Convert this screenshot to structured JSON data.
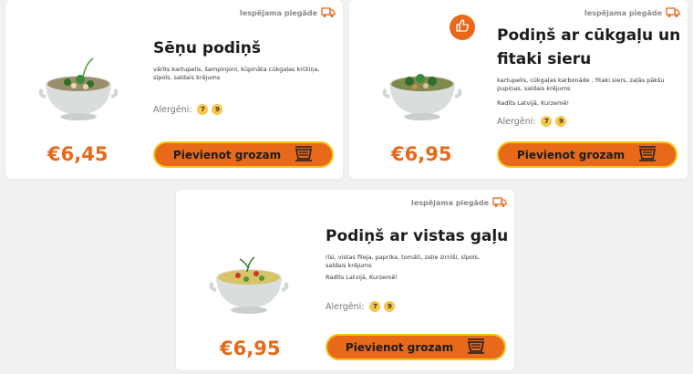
{
  "delivery_label": "Iespējama piegāde",
  "allergens_label": "Alergēni:",
  "cart_button_label": "Pievienot grozam",
  "colors": {
    "accent": "#e8691a",
    "button_border": "#f5c518",
    "badge": "#f7c64a"
  },
  "products": [
    {
      "title": "Sēņu podiņš",
      "ingredients": "vārīts kartupelis, šampinjoni,  kūpināta cūkgaļas krūtiņa, sīpols, saldais krējums",
      "origin": "",
      "allergens": [
        "7",
        "9"
      ],
      "price": "€6,45"
    },
    {
      "title": "Podiņš ar cūkgaļu un\nfitaki sieru",
      "ingredients": "kartupelis, cūkgaļas karbonāde , fitaki siers, zaļās pākšu pupiņas, saldais krējums",
      "origin": "Radīts Latvijā, Kurzemē!",
      "allergens": [
        "7",
        "9"
      ],
      "price": "€6,95"
    },
    {
      "title": "Podiņš ar vistas gaļu",
      "ingredients": "rīsi, vistas fileja, paprika, tomāti, zaļie zirnīši, sīpols, saldais krējums",
      "origin": "Radīts Latvijā, Kurzemē!",
      "allergens": [
        "7",
        "9"
      ],
      "price": "€6,95"
    }
  ]
}
